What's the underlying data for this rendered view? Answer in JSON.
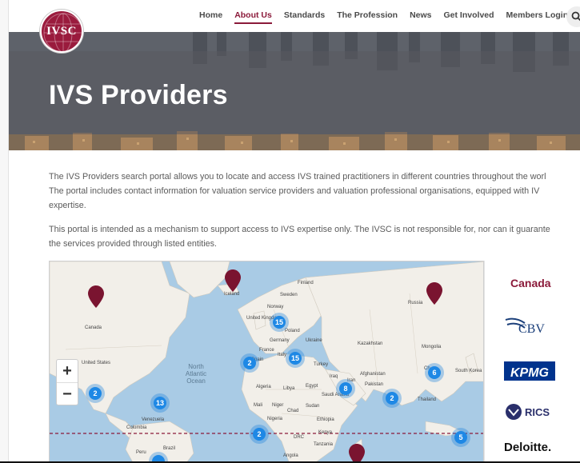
{
  "brand": {
    "logo_text": "IVSC",
    "primary_color": "#8b1a3a"
  },
  "nav": {
    "items": [
      {
        "label": "Home",
        "active": false
      },
      {
        "label": "About Us",
        "active": true
      },
      {
        "label": "Standards",
        "active": false
      },
      {
        "label": "The Profession",
        "active": false
      },
      {
        "label": "News",
        "active": false
      },
      {
        "label": "Get Involved",
        "active": false
      },
      {
        "label": "Members Login",
        "active": false
      }
    ],
    "search_icon": "search-icon"
  },
  "hero": {
    "title": "IVS Providers"
  },
  "intro": {
    "paragraph1": "The IVS Providers search portal allows you to locate and access IVS trained practitioners in different countries throughout the worl",
    "paragraph1_line2": "The portal includes contact information for valuation service providers and valuation professional organisations, equipped with IV",
    "paragraph1_line3": "expertise.",
    "paragraph2": "This portal is intended as a mechanism to support access to IVS expertise only. The IVSC is not responsible for, nor can it guarante",
    "paragraph2_line2": "the services provided through listed entities."
  },
  "map": {
    "zoom_in": "+",
    "zoom_out": "−",
    "ocean_label": [
      "North",
      "Atlantic",
      "Ocean"
    ],
    "clusters": [
      "15",
      "2",
      "15",
      "6",
      "2",
      "13",
      "8",
      "2",
      "2",
      "5"
    ],
    "country_labels": {
      "finland": "Finland",
      "sweden": "Sweden",
      "norway": "Norway",
      "uk": "United Kingdom",
      "poland": "Poland",
      "germany": "Germany",
      "ukraine": "Ukraine",
      "france": "France",
      "italy": "Italy",
      "spain": "Spain",
      "turkey": "Turkey",
      "kazakhstan": "Kazakhstan",
      "mongolia": "Mongolia",
      "russia": "Russia",
      "canada": "Canada",
      "iceland": "Iceland",
      "us": "United States",
      "algeria": "Algeria",
      "libya": "Libya",
      "egypt": "Egypt",
      "iraq": "Iraq",
      "iran": "Iran",
      "afghanistan": "Afghanistan",
      "pakistan": "Pakistan",
      "saudi": "Saudi Arabia",
      "mali": "Mali",
      "niger": "Niger",
      "chad": "Chad",
      "sudan": "Sudan",
      "nigeria": "Nigeria",
      "ethiopia": "Ethiopia",
      "thailand": "Thailand",
      "southkorea": "South Korea",
      "venezuela": "Venezuela",
      "colombia": "Colombia",
      "brazil": "Brazil",
      "peru": "Peru",
      "drc": "DRC",
      "kenya": "Kenya",
      "tanzania": "Tanzania",
      "angola": "Angola",
      "ch": "Ch"
    }
  },
  "sidebar": {
    "country": "Canada",
    "logos": [
      "CBV",
      "KPMG",
      "RICS",
      "Deloitte."
    ]
  }
}
